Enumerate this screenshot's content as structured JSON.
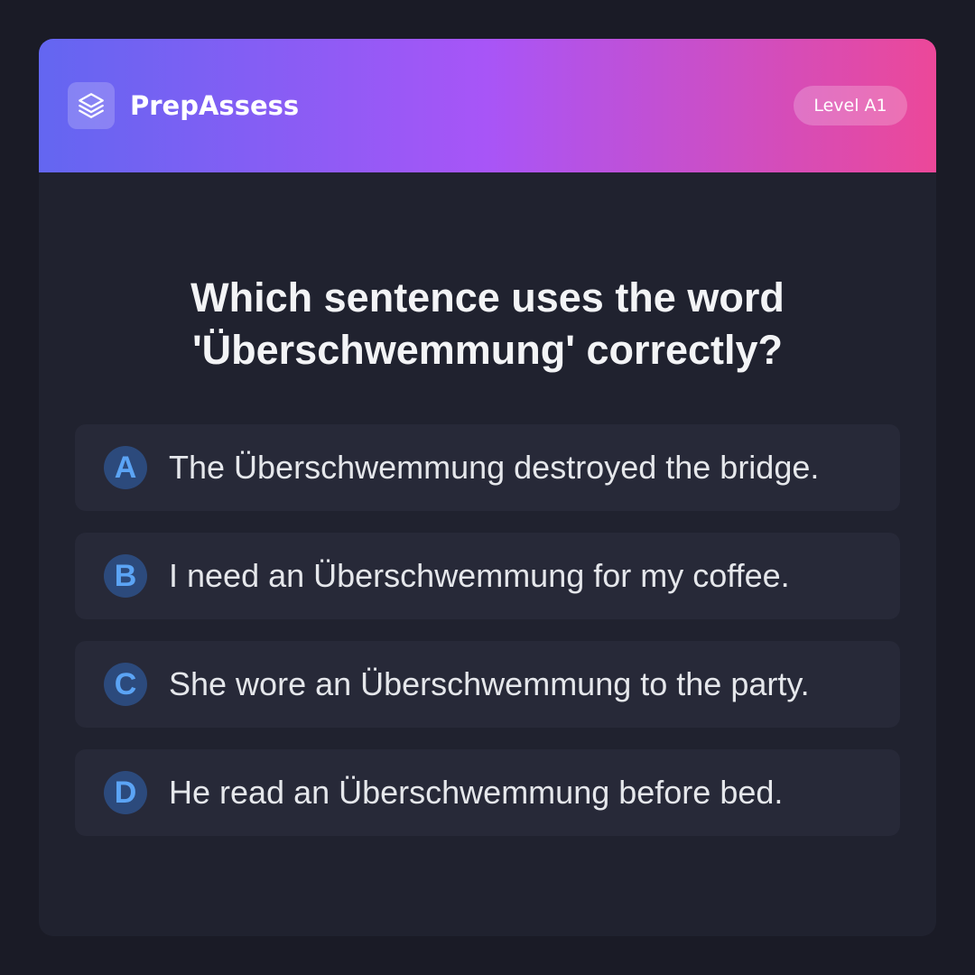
{
  "header": {
    "brand_icon": "layers-icon",
    "brand_name": "PrepAssess",
    "level_badge": "Level A1"
  },
  "question": {
    "text": "Which sentence uses the word 'Überschwemmung' correctly?"
  },
  "options": [
    {
      "letter": "A",
      "text": "The Überschwemmung destroyed the bridge."
    },
    {
      "letter": "B",
      "text": "I need an Überschwemmung for my coffee."
    },
    {
      "letter": "C",
      "text": "She wore an Überschwemmung to the party."
    },
    {
      "letter": "D",
      "text": "He read an Überschwemmung before bed."
    }
  ],
  "colors": {
    "page_background": "#1a1b26",
    "card_background": "#20222f",
    "header_gradient": [
      "#6366f1",
      "#a855f7",
      "#ec4899"
    ],
    "option_background": "#272938",
    "letter_circle": "#2c4a7c",
    "letter_color": "#5ba4f5"
  }
}
